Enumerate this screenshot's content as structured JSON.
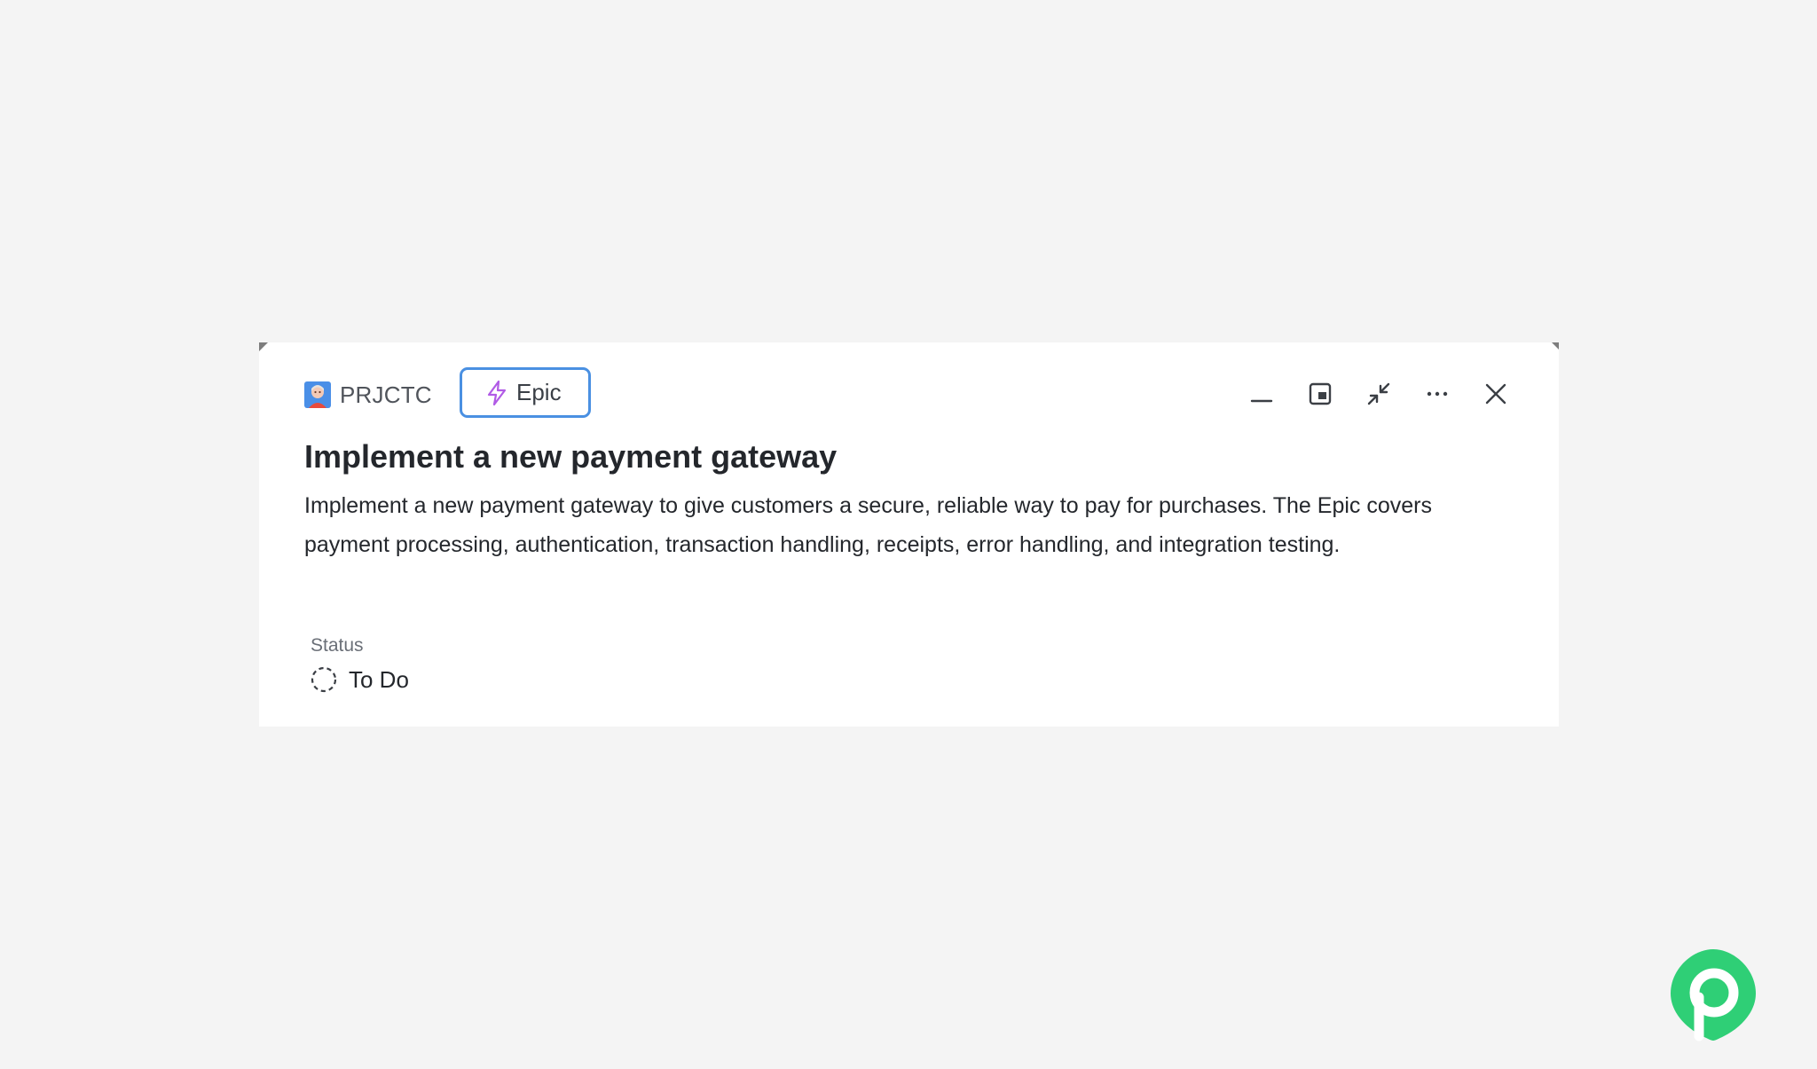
{
  "issue": {
    "project_key": "PRJCTC",
    "type_label": "Epic",
    "title": "Implement a new payment gateway",
    "description": "Implement a new payment gateway to give customers a secure, reliable way to pay for purchases. The Epic covers payment processing, authentication, transaction handling, receipts, error handling, and integration testing.",
    "status_label": "Status",
    "status_value": "To Do"
  },
  "icons": {
    "project_avatar": "project-avatar-icon",
    "type": "lightning-icon",
    "minimize": "minimize-icon",
    "picture_in_picture": "picture-in-picture-icon",
    "collapse": "collapse-arrows-icon",
    "more": "more-horizontal-icon",
    "close": "close-icon",
    "status": "dashed-circle-icon",
    "brand": "plane-logo-icon"
  },
  "colors": {
    "background": "#f4f4f4",
    "panel": "#ffffff",
    "chip_border": "#4a90e2",
    "epic_accent": "#b15be6",
    "brand": "#2fcf76"
  }
}
